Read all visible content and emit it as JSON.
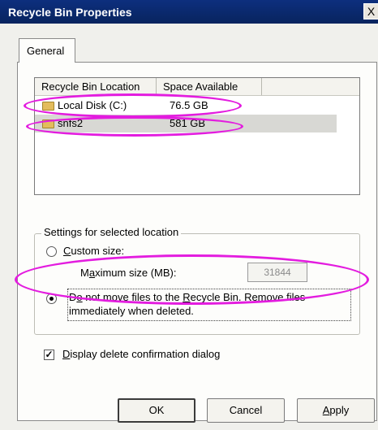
{
  "window": {
    "title": "Recycle Bin Properties",
    "close_glyph": "X"
  },
  "tabs": [
    {
      "label": "General",
      "active": true
    }
  ],
  "list": {
    "columns": [
      "Recycle Bin Location",
      "Space Available"
    ],
    "rows": [
      {
        "name": "Local Disk (C:)",
        "space": "76.5 GB",
        "icon": "drive-icon"
      },
      {
        "name": "snfs2",
        "space": "581 GB",
        "icon": "drive-icon",
        "selected": true
      }
    ]
  },
  "settings": {
    "legend": "Settings for selected location",
    "custom_size": {
      "label_pre": "",
      "label_u": "C",
      "label_post": "ustom size:",
      "checked": false
    },
    "max_size": {
      "label_pre": "M",
      "label_u": "a",
      "label_post": "ximum size (MB):",
      "value": "31844"
    },
    "no_move": {
      "label_pre": "D",
      "label_u": "o",
      "label_post": " not move files to the ",
      "label_u2": "R",
      "label_post2": "ecycle Bin. Remove files",
      "line2": "immediately when deleted.",
      "checked": true
    }
  },
  "confirm": {
    "label_u": "D",
    "label_post": "isplay delete confirmation dialog",
    "checked": true,
    "check_glyph": "✓"
  },
  "buttons": {
    "ok": "OK",
    "cancel": "Cancel",
    "apply_u": "A",
    "apply_post": "pply"
  },
  "annotation_color": "#e31cdf"
}
